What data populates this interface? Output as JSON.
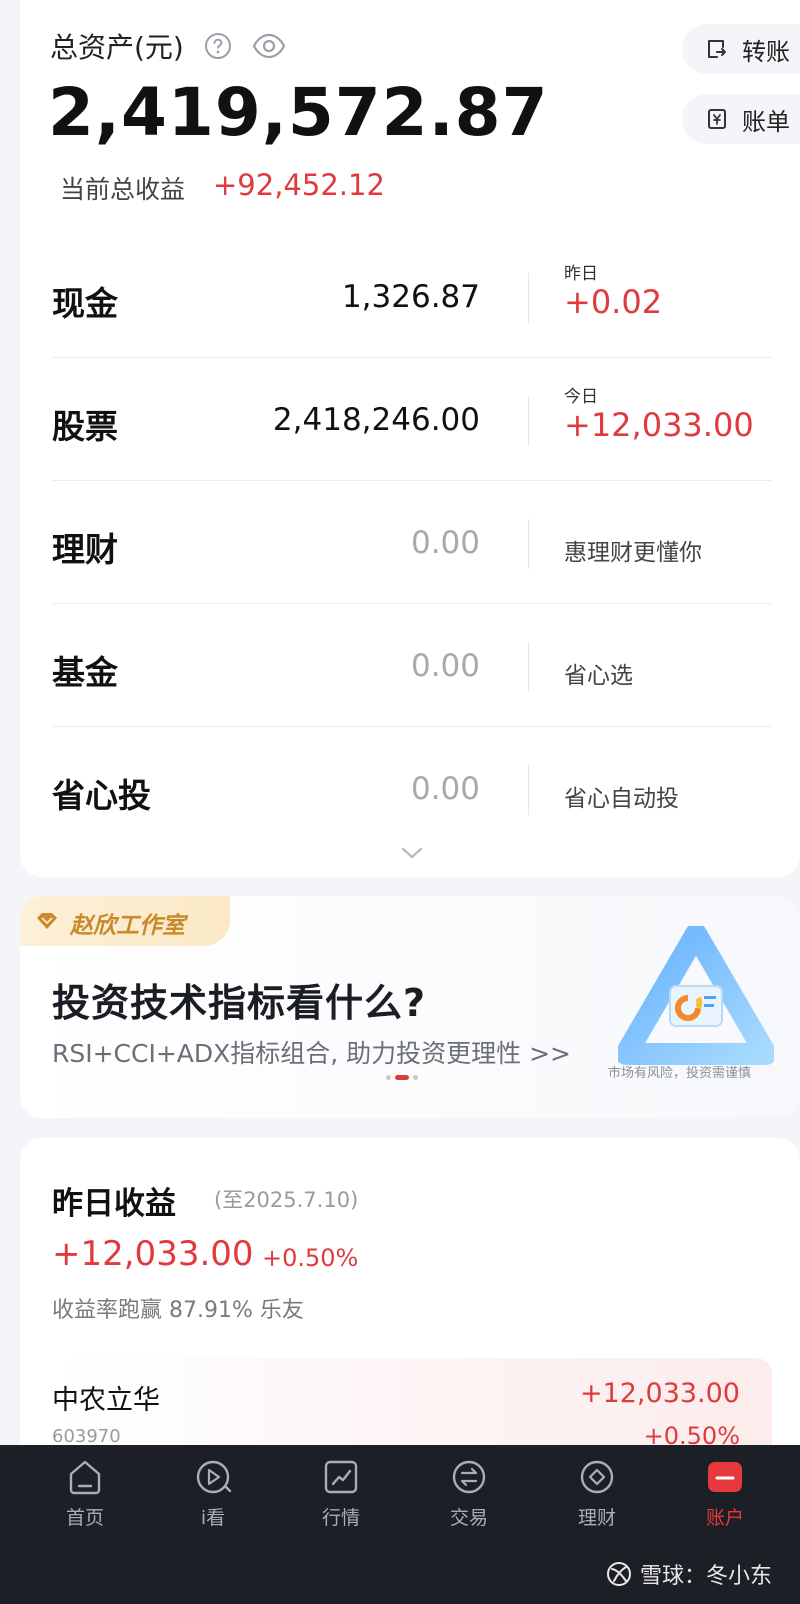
{
  "header": {
    "total_assets_label": "总资产(元)",
    "total_assets_value": "2,419,572.87",
    "total_profit_label": "当前总收益",
    "total_profit_value": "+92,452.12",
    "transfer_label": "转账",
    "bill_label": "账单"
  },
  "assets": [
    {
      "label": "现金",
      "amount": "1,326.87",
      "side_small": "昨日",
      "side_value": "+0.02"
    },
    {
      "label": "股票",
      "amount": "2,418,246.00",
      "side_small": "今日",
      "side_value": "+12,033.00"
    },
    {
      "label": "理财",
      "amount": "0.00",
      "side_desc": "惠理财更懂你"
    },
    {
      "label": "基金",
      "amount": "0.00",
      "side_desc": "省心选"
    },
    {
      "label": "省心投",
      "amount": "0.00",
      "side_desc": "省心自动投"
    }
  ],
  "banner": {
    "studio": "赵欣工作室",
    "title": "投资技术指标看什么?",
    "subtitle": "RSI+CCI+ADX指标组合, 助力投资更理性 >>",
    "risk_note": "市场有风险，投资需谨慎"
  },
  "earnings": {
    "title": "昨日收益",
    "date": "(至2025.7.10)",
    "amount": "+12,033.00",
    "rate": "+0.50%",
    "beat_text": "收益率跑赢 87.91% 乐友",
    "stock": {
      "name": "中农立华",
      "code": "603970",
      "amount": "+12,033.00",
      "rate": "+0.50%"
    }
  },
  "tabs": [
    {
      "label": "首页",
      "icon": "home-icon"
    },
    {
      "label": "i看",
      "icon": "play-icon"
    },
    {
      "label": "行情",
      "icon": "chart-icon"
    },
    {
      "label": "交易",
      "icon": "exchange-icon"
    },
    {
      "label": "理财",
      "icon": "diamond-icon"
    },
    {
      "label": "账户",
      "icon": "account-icon"
    }
  ],
  "watermark": "雪球：冬小东",
  "colors": {
    "up": "#e03a3e",
    "tab_active": "#e5393d",
    "tabbar_bg": "#1c1f25"
  }
}
